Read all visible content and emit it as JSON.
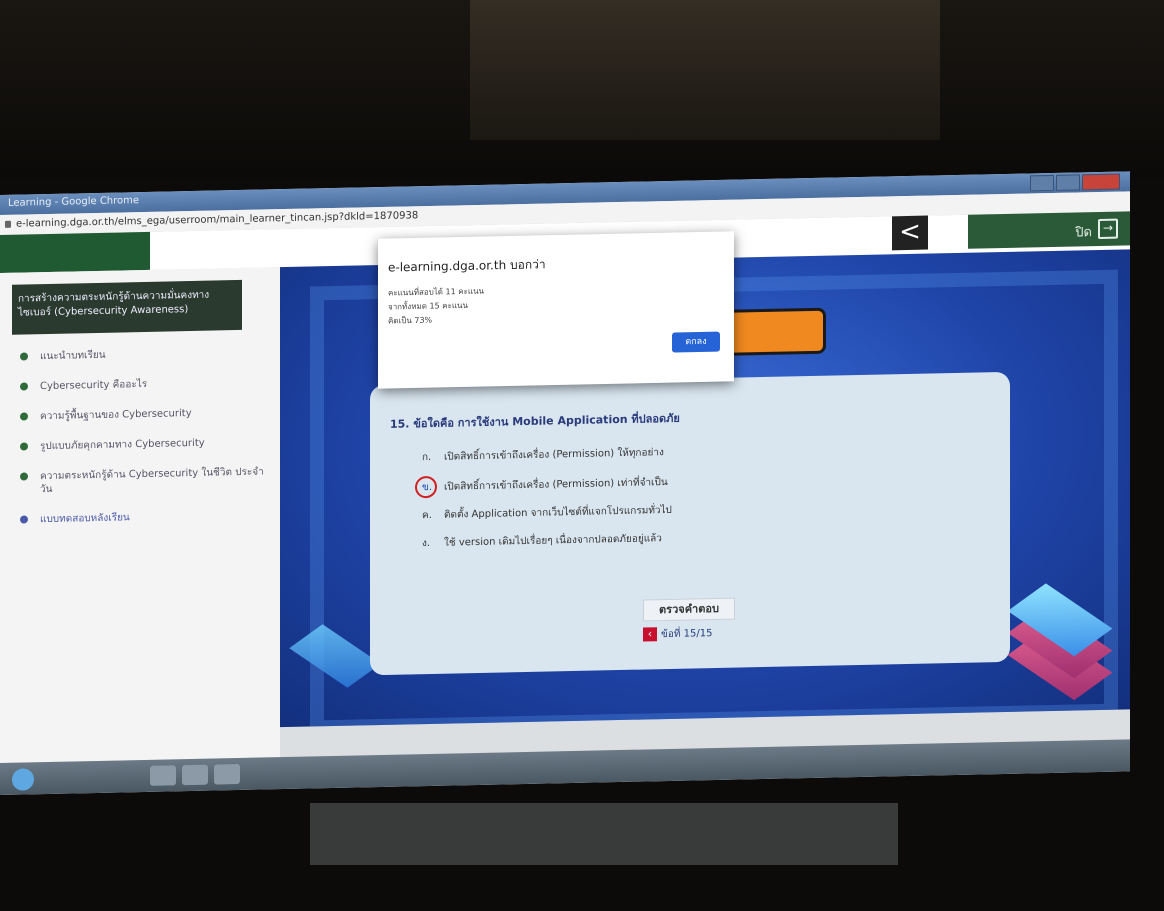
{
  "browser": {
    "window_title": "Learning - Google Chrome",
    "url": "e-learning.dga.or.th/elms_ega/userroom/main_learner_tincan.jsp?dkld=1870938"
  },
  "header": {
    "back_glyph": "<",
    "exit_label": "ปิด",
    "exit_glyph": "→"
  },
  "sidebar": {
    "course_title": "การสร้างความตระหนักรู้ด้านความมั่นคงทางไซเบอร์ (Cybersecurity Awareness)",
    "items": [
      {
        "label": "แนะนำบทเรียน"
      },
      {
        "label": "Cybersecurity คืออะไร"
      },
      {
        "label": "ความรู้พื้นฐานของ Cybersecurity"
      },
      {
        "label": "รูปแบบภัยคุกคามทาง Cybersecurity"
      },
      {
        "label": "ความตระหนักรู้ด้าน Cybersecurity ในชีวิต ประจำวัน"
      },
      {
        "label": "แบบทดสอบหลังเรียน"
      }
    ]
  },
  "quiz": {
    "question": "15. ข้อใดคือ การใช้งาน Mobile Application ที่ปลอดภัย",
    "options": [
      {
        "key": "ก.",
        "text": "เปิดสิทธิ์การเข้าถึงเครื่อง (Permission) ให้ทุกอย่าง"
      },
      {
        "key": "ข.",
        "text": "เปิดสิทธิ์การเข้าถึงเครื่อง (Permission) เท่าที่จำเป็น"
      },
      {
        "key": "ค.",
        "text": "ติดตั้ง Application จากเว็บไซต์ที่แจกโปรแกรมทั่วไป"
      },
      {
        "key": "ง.",
        "text": "ใช้ version เดิมไปเรื่อยๆ เนื่องจากปลอดภัยอยู่แล้ว"
      }
    ],
    "selected_option": "ข.",
    "check_button": "ตรวจคำตอบ",
    "pager": "ข้อที่ 15/15"
  },
  "dialog": {
    "title": "e-learning.dga.or.th บอกว่า",
    "lines": [
      "คะแนนที่สอบได้ 11 คะแนน",
      "จากทั้งหมด 15 คะแนน",
      "คิดเป็น 73%"
    ],
    "ok_label": "ตกลง"
  },
  "colors": {
    "accent_green": "#2a5a38",
    "stage_blue": "#1f44a8",
    "orange": "#f08a20",
    "dialog_button": "#2563d6",
    "selection_circle": "#d02020"
  },
  "icons": [
    "back-chevron-icon",
    "exit-icon",
    "bullet-dot-icon",
    "prev-arrow-icon",
    "lock-icon",
    "cube-decoration-icon"
  ]
}
